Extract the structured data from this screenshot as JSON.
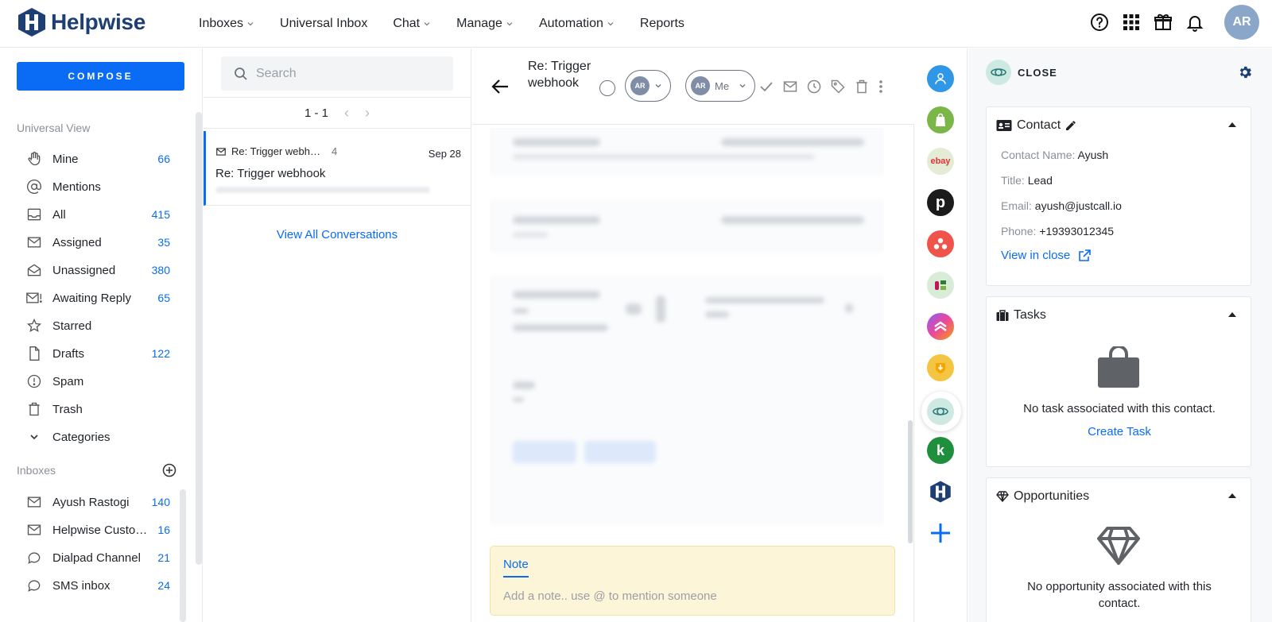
{
  "app": {
    "brand": "Helpwise",
    "avatar_initials": "AR"
  },
  "nav": {
    "items": [
      {
        "label": "Inboxes",
        "dropdown": true
      },
      {
        "label": "Universal Inbox",
        "dropdown": false
      },
      {
        "label": "Chat",
        "dropdown": true
      },
      {
        "label": "Manage",
        "dropdown": true
      },
      {
        "label": "Automation",
        "dropdown": true
      },
      {
        "label": "Reports",
        "dropdown": false
      }
    ]
  },
  "sidebar": {
    "compose_label": "COMPOSE",
    "universal_label": "Universal View",
    "items": [
      {
        "label": "Mine",
        "count": "66",
        "icon": "hand-icon"
      },
      {
        "label": "Mentions",
        "count": "",
        "icon": "at-icon"
      },
      {
        "label": "All",
        "count": "415",
        "icon": "inbox-icon"
      },
      {
        "label": "Assigned",
        "count": "35",
        "icon": "envelope-icon"
      },
      {
        "label": "Unassigned",
        "count": "380",
        "icon": "open-envelope-icon"
      },
      {
        "label": "Awaiting Reply",
        "count": "65",
        "icon": "envelope-alert-icon"
      },
      {
        "label": "Starred",
        "count": "",
        "icon": "star-icon"
      },
      {
        "label": "Drafts",
        "count": "122",
        "icon": "file-icon"
      },
      {
        "label": "Spam",
        "count": "",
        "icon": "alert-circle-icon"
      },
      {
        "label": "Trash",
        "count": "",
        "icon": "trash-icon"
      },
      {
        "label": "Categories",
        "count": "",
        "icon": "chevron-down-icon"
      }
    ],
    "inboxes_label": "Inboxes",
    "inboxes": [
      {
        "label": "Ayush Rastogi",
        "count": "140",
        "icon": "envelope-icon"
      },
      {
        "label": "Helpwise Custo…",
        "count": "16",
        "icon": "envelope-icon"
      },
      {
        "label": "Dialpad Channel",
        "count": "21",
        "icon": "chat-bubble-icon"
      },
      {
        "label": "SMS inbox",
        "count": "24",
        "icon": "chat-bubble-icon"
      }
    ]
  },
  "convlist": {
    "search_placeholder": "Search",
    "pager": "1 - 1",
    "conversation": {
      "subject_short": "Re: Trigger webh…",
      "count": "4",
      "date": "Sep 28",
      "title": "Re: Trigger webhook"
    },
    "view_all": "View All Conversations"
  },
  "thread": {
    "title": "Re: Trigger webhook",
    "assignee_initials": "AR",
    "me_label": "Me",
    "note_tab": "Note",
    "note_placeholder": "Add a note.. use @ to mention someone"
  },
  "rail": {
    "icons": [
      {
        "name": "contact-icon",
        "color": "#2f97e6"
      },
      {
        "name": "shopify-icon",
        "color": "#7ab648"
      },
      {
        "name": "ebay-icon",
        "color": "#e5ecd6"
      },
      {
        "name": "pipedrive-icon",
        "color": "#1b1b1b"
      },
      {
        "name": "asana-icon",
        "color": "#f0534a"
      },
      {
        "name": "tags-icon",
        "color": "#d9ecd7"
      },
      {
        "name": "clickup-icon",
        "color": "#7b5cf5"
      },
      {
        "name": "badge-icon",
        "color": "#f4c542"
      },
      {
        "name": "close-crm-icon",
        "color": "#cde9e2"
      },
      {
        "name": "klaviyo-icon",
        "color": "#1f8f3e"
      },
      {
        "name": "helpwise-icon",
        "color": "#1d3f73"
      },
      {
        "name": "plus-icon",
        "color": "#0a6cf5"
      }
    ]
  },
  "right_panel": {
    "brand": "CLOSE",
    "contact": {
      "title": "Contact",
      "fields": [
        {
          "key": "Contact Name:",
          "value": "Ayush"
        },
        {
          "key": "Title:",
          "value": "Lead"
        },
        {
          "key": "Email:",
          "value": "ayush@justcall.io"
        },
        {
          "key": "Phone:",
          "value": "+19393012345"
        }
      ],
      "view_link": "View in close"
    },
    "tasks": {
      "title": "Tasks",
      "empty": "No task associated with this contact.",
      "action": "Create Task"
    },
    "opportunities": {
      "title": "Opportunities",
      "empty": "No opportunity associated with this contact."
    }
  }
}
